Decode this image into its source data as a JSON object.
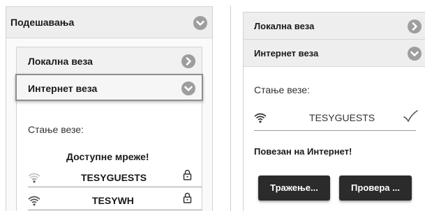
{
  "left_panel": {
    "header_title": "Подешавања",
    "accordion": [
      {
        "label": "Локална веза",
        "expanded": false
      },
      {
        "label": "Интернет веза",
        "expanded": true
      }
    ],
    "status_label": "Стање везе:",
    "networks_title": "Доступне мреже!",
    "networks": [
      {
        "name": "TESYGUESTS",
        "locked": true
      },
      {
        "name": "TESYWH",
        "locked": true
      }
    ]
  },
  "right_panel": {
    "accordion": [
      {
        "label": "Локална веза",
        "expanded": false
      },
      {
        "label": "Интернет веза",
        "expanded": true
      }
    ],
    "status_label": "Стање везе:",
    "connected_network": "TESYGUESTS",
    "connected_message": "Повезан на Интернет!",
    "buttons": {
      "search_label": "Тражење...",
      "check_label": "Провера ..."
    }
  },
  "icons": {
    "expand": "chevron-down-icon",
    "collapsed": "chevron-right-icon",
    "wifi": "wifi-icon",
    "lock": "lock-icon",
    "checkmark": "checkmark-icon"
  },
  "colors": {
    "icon_gray": "#9e9e9e",
    "button_dark": "#2b2b2b",
    "header_bg": "#eeeeee"
  }
}
